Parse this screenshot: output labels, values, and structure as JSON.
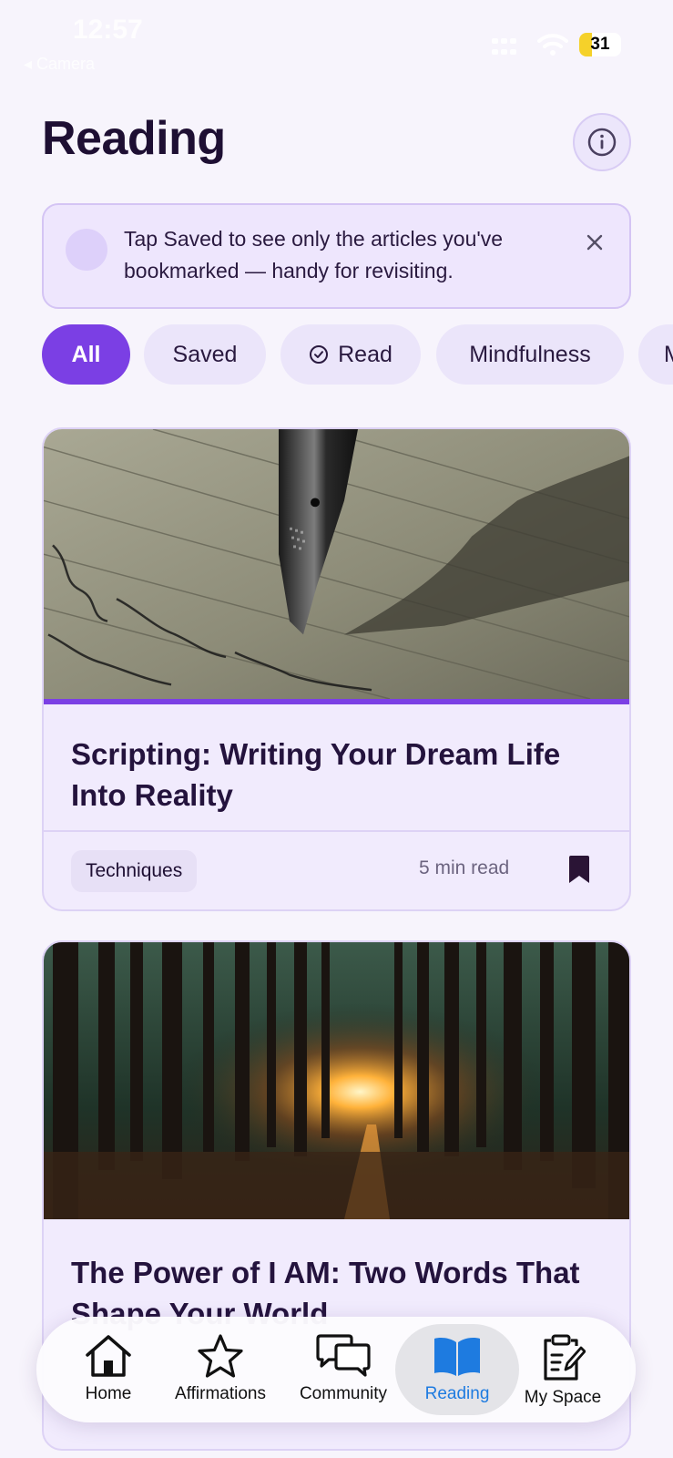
{
  "status_bar": {
    "time": "12:57",
    "back_label": "◂ Camera",
    "battery_level": "31",
    "battery_fraction": 0.31
  },
  "header": {
    "title": "Reading",
    "info_icon": "info-icon"
  },
  "tip_banner": {
    "text": "Tap Saved to see only the articles you've bookmarked — handy for revisiting.",
    "close_icon": "close-icon"
  },
  "filters": {
    "chips": [
      {
        "label": "All",
        "active": true
      },
      {
        "label": "Saved",
        "active": false
      },
      {
        "label": "Read",
        "active": false,
        "icon": "check-circle-icon"
      },
      {
        "label": "Mindfulness",
        "active": false
      },
      {
        "label": "M",
        "active": false
      }
    ]
  },
  "articles": [
    {
      "image": "fountain-pen-writing-photo",
      "title": "Scripting: Writing Your Dream Life Into Reality",
      "category": "Techniques",
      "read_time": "5 min read",
      "bookmarked": true
    },
    {
      "image": "forest-sunlight-photo",
      "title": "The Power of I AM: Two Words That Shape Your World"
    }
  ],
  "nav": {
    "items": [
      {
        "label": "Home",
        "icon": "home-icon",
        "active": false
      },
      {
        "label": "Affirmations",
        "icon": "star-icon",
        "active": false
      },
      {
        "label": "Community",
        "icon": "chat-bubbles-icon",
        "active": false
      },
      {
        "label": "Reading",
        "icon": "book-icon",
        "active": true
      },
      {
        "label": "My Space",
        "icon": "clipboard-pen-icon",
        "active": false
      }
    ]
  },
  "colors": {
    "accent": "#7b3fe4",
    "nav_active": "#1e7be0",
    "background": "#f7f4fc",
    "card": "#f1ebfd"
  }
}
